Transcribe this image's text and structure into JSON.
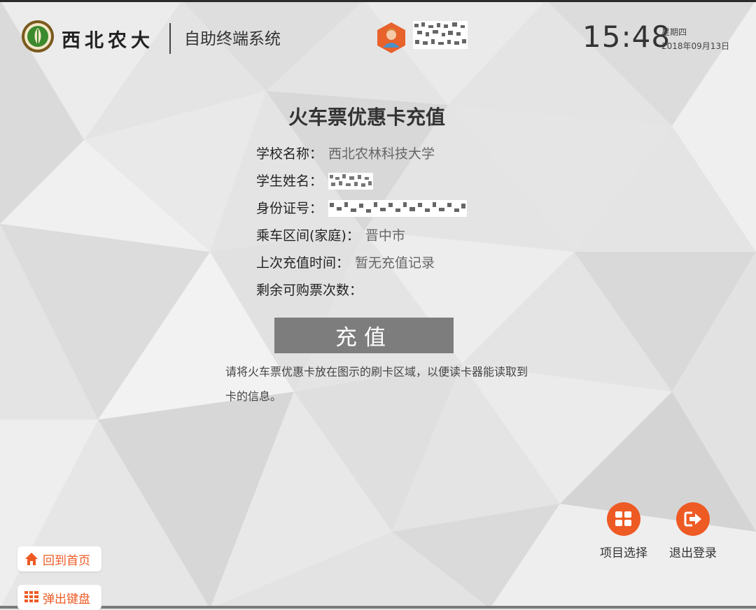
{
  "header": {
    "logo_text": "西北农大",
    "system_title": "自助终端系统",
    "clock_time": "15:48",
    "weekday": "星期四",
    "date": "2018年09月13日"
  },
  "main": {
    "title": "火车票优惠卡充值",
    "fields": [
      {
        "label": "学校名称：",
        "value": "西北农林科技大学"
      },
      {
        "label": "学生姓名：",
        "value": ""
      },
      {
        "label": "身份证号：",
        "value": ""
      },
      {
        "label": "乘车区间(家庭)：",
        "value": "晋中市"
      },
      {
        "label": "上次充值时间：",
        "value": "暂无充值记录"
      },
      {
        "label": "剩余可购票次数：",
        "value": ""
      }
    ],
    "recharge_button": "充值",
    "hint": "请将火车票优惠卡放在图示的刷卡区域，以便读卡器能读取到卡的信息。"
  },
  "actions": {
    "projects_label": "项目选择",
    "logout_label": "退出登录",
    "home_label": "回到首页",
    "keyboard_label": "弹出键盘"
  },
  "colors": {
    "accent": "#ee5a24",
    "button_gray": "#7d7d7d",
    "background": "#e6e6e6"
  },
  "icons": {
    "projects": "grid-icon",
    "logout": "exit-icon",
    "home": "home-icon",
    "keyboard": "keyboard-icon",
    "avatar": "user-avatar-icon"
  }
}
